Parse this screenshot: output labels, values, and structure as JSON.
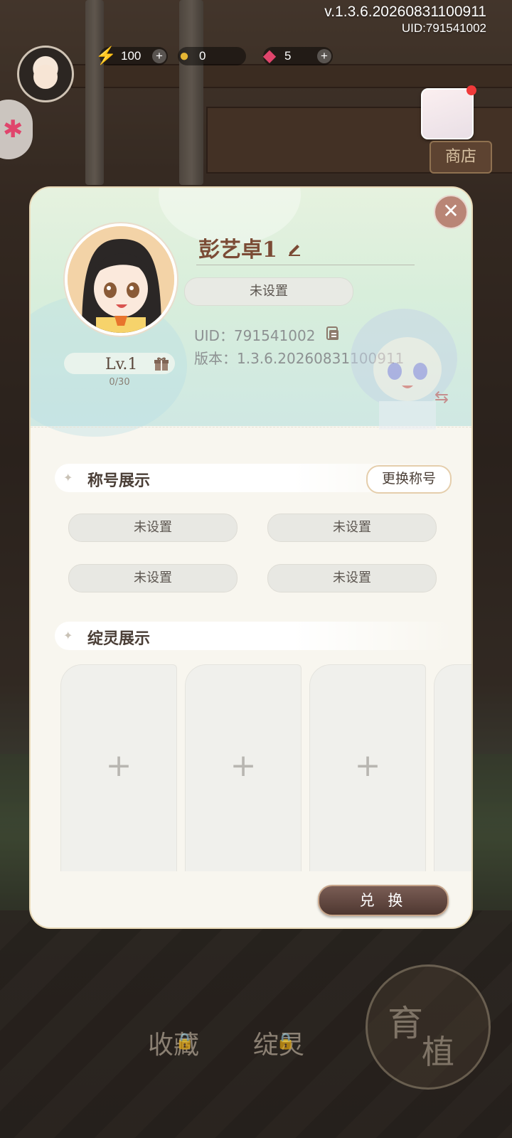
{
  "hud": {
    "version": "v.1.3.6.20260831100911",
    "uid": "UID:791541002",
    "energy": "100",
    "coins": "0",
    "gems": "5",
    "shop_label": "商店",
    "nav_collection": "收藏",
    "nav_spirit": "绽灵",
    "grow_a": "育",
    "grow_b": "植"
  },
  "profile": {
    "name": "彭艺卓1",
    "signature": "未设置",
    "uid_text": "UID：791541002",
    "version_text": "版本：1.3.6.20260831100911",
    "level": "Lv.1",
    "exp": "0/30"
  },
  "titles_section": {
    "heading": "称号展示",
    "change_button": "更换称号",
    "slots": [
      "未设置",
      "未设置",
      "未设置",
      "未设置"
    ]
  },
  "spirit_section": {
    "heading": "绽灵展示",
    "card_plus": "+"
  },
  "redeem_button": "兑 换",
  "close_glyph": "✕",
  "colors": {
    "accent_brown": "#7b4b35",
    "close_button": "#b98576",
    "redeem_button": "#5a403a",
    "notification_dot": "#f03a3a"
  }
}
